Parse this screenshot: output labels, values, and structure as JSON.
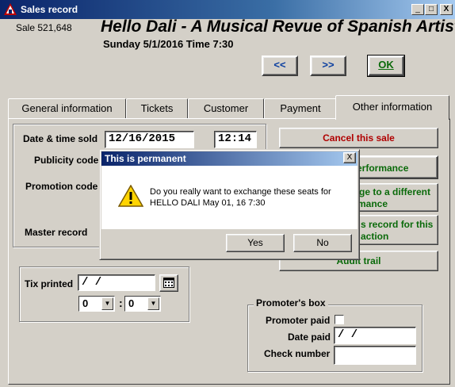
{
  "window": {
    "title": "Sales record",
    "controls": [
      "_",
      "□",
      "X"
    ]
  },
  "header": {
    "sale_number": "Sale 521,648",
    "show_title": "Hello Dali - A Musical Revue of Spanish Artists",
    "show_datetime": "Sunday 5/1/2016  Time 7:30",
    "prev_label": "<<",
    "next_label": ">>",
    "ok_label": "OK"
  },
  "tabs": [
    {
      "label": "General information"
    },
    {
      "label": "Tickets"
    },
    {
      "label": "Customer"
    },
    {
      "label": "Payment"
    },
    {
      "label": "Other information"
    }
  ],
  "form": {
    "date_time_label": "Date & time sold",
    "date_value": "12/16/2015",
    "time_value": "12:14",
    "publicity_label": "Publicity code",
    "promotion_label": "Promotion code",
    "master_label": "Master record",
    "tix_printed_label": "Tix printed",
    "tix_date_value": " / /",
    "hour_value": "0",
    "minute_value": "0",
    "colon": ":"
  },
  "side_buttons": {
    "cancel": "Cancel this sale",
    "exchange_perf": "erformance",
    "exchange_diff_1": "ge to a different",
    "exchange_diff_2": "mance",
    "records_1": "s record for this",
    "records_2": "action",
    "audit": "Audit trail"
  },
  "promoter": {
    "legend": "Promoter's box",
    "paid_label": "Promoter paid",
    "date_paid_label": "Date paid",
    "date_paid_value": " / /",
    "check_label": "Check number",
    "check_value": ""
  },
  "dialog": {
    "title": "This is permanent",
    "message_line1": "Do you really want to exchange these seats for",
    "message_line2": "HELLO DALI May 01, 16 7:30",
    "yes_label": "Yes",
    "no_label": "No",
    "close_glyph": "X"
  },
  "colors": {
    "title_gradient_start": "#0a246a",
    "title_gradient_end": "#a6caf0",
    "nav_text": "#0a3ea0",
    "green_text": "#0a6a0a",
    "red_text": "#b00000",
    "face": "#d4d0c8"
  }
}
